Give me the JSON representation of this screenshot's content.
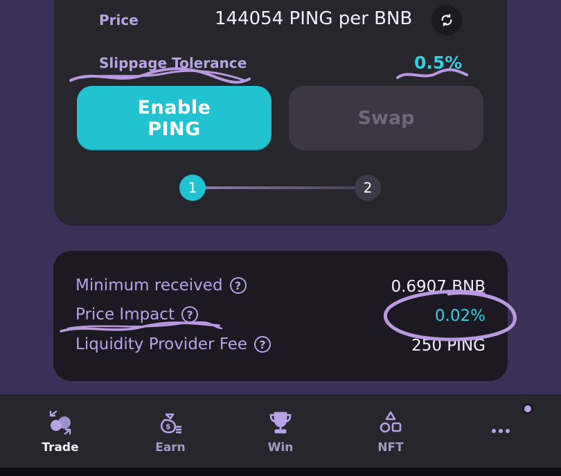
{
  "swap": {
    "price_label": "Price",
    "price_value": "144054 PING per BNB",
    "slippage_label": "Slippage Tolerance",
    "slippage_value": "0.5%",
    "enable_button": "Enable\nPING",
    "swap_button": "Swap",
    "steps": [
      "1",
      "2"
    ]
  },
  "details": {
    "minimum_received_label": "Minimum received",
    "minimum_received_value": "0.6907 BNB",
    "price_impact_label": "Price Impact",
    "price_impact_value": "0.02%",
    "lp_fee_label": "Liquidity Provider Fee",
    "lp_fee_value": "250 PING",
    "help_glyph": "?"
  },
  "nav": {
    "items": [
      {
        "label": "Trade",
        "icon": "trade-icon",
        "active": true
      },
      {
        "label": "Earn",
        "icon": "earn-icon",
        "active": false
      },
      {
        "label": "Win",
        "icon": "trophy-icon",
        "active": false
      },
      {
        "label": "NFT",
        "icon": "nft-icon",
        "active": false
      }
    ],
    "more_icon": "more-icon"
  },
  "colors": {
    "background": "#3a3058",
    "card": "#27262c",
    "accent_teal": "#22c3d1",
    "label_purple": "#b7a4e6",
    "scribble": "#b99ae0"
  }
}
